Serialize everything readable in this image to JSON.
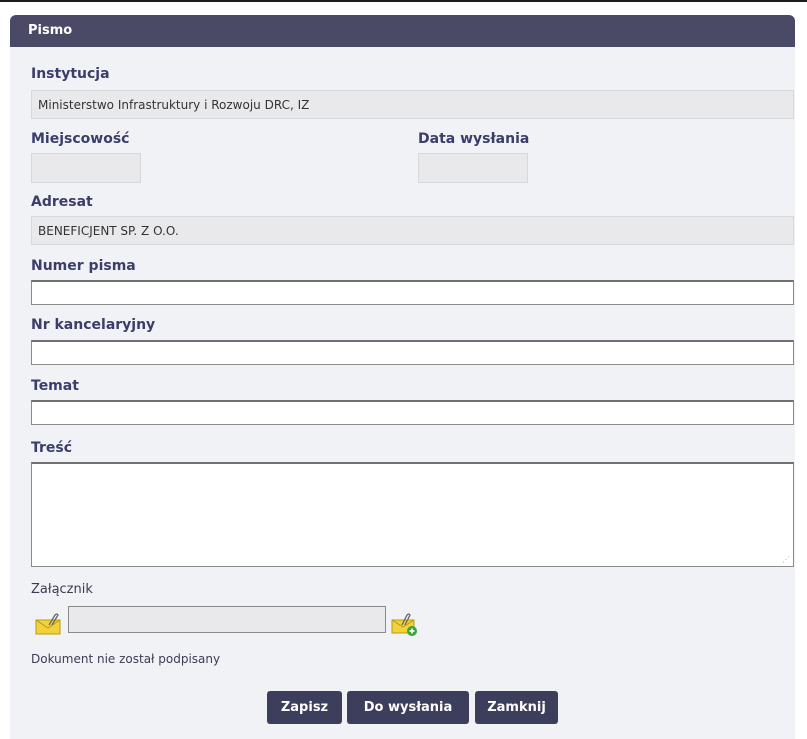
{
  "window": {
    "title": "Pismo"
  },
  "form": {
    "institution": {
      "label": "Instytucja",
      "value": "Ministerstwo Infrastruktury i Rozwoju DRC, IZ"
    },
    "city": {
      "label": "Miejscowość",
      "value": ""
    },
    "send_date": {
      "label": "Data wysłania",
      "value": ""
    },
    "addressee": {
      "label": "Adresat",
      "value": "BENEFICJENT SP. Z O.O."
    },
    "letter_number": {
      "label": "Numer pisma",
      "value": ""
    },
    "office_number": {
      "label": "Nr kancelaryjny",
      "value": ""
    },
    "subject": {
      "label": "Temat",
      "value": ""
    },
    "content": {
      "label": "Treść",
      "value": ""
    },
    "attachment": {
      "label": "Załącznik",
      "value": "",
      "attach_icon": "paperclip-envelope-icon",
      "add_icon": "envelope-add-icon"
    },
    "sign_status": "Dokument nie został podpisany"
  },
  "buttons": {
    "save": "Zapisz",
    "to_send": "Do wysłania",
    "close": "Zamknij"
  },
  "colors": {
    "header": "#4a4a66",
    "button": "#3d3d5c",
    "label": "#3b3d6b"
  }
}
